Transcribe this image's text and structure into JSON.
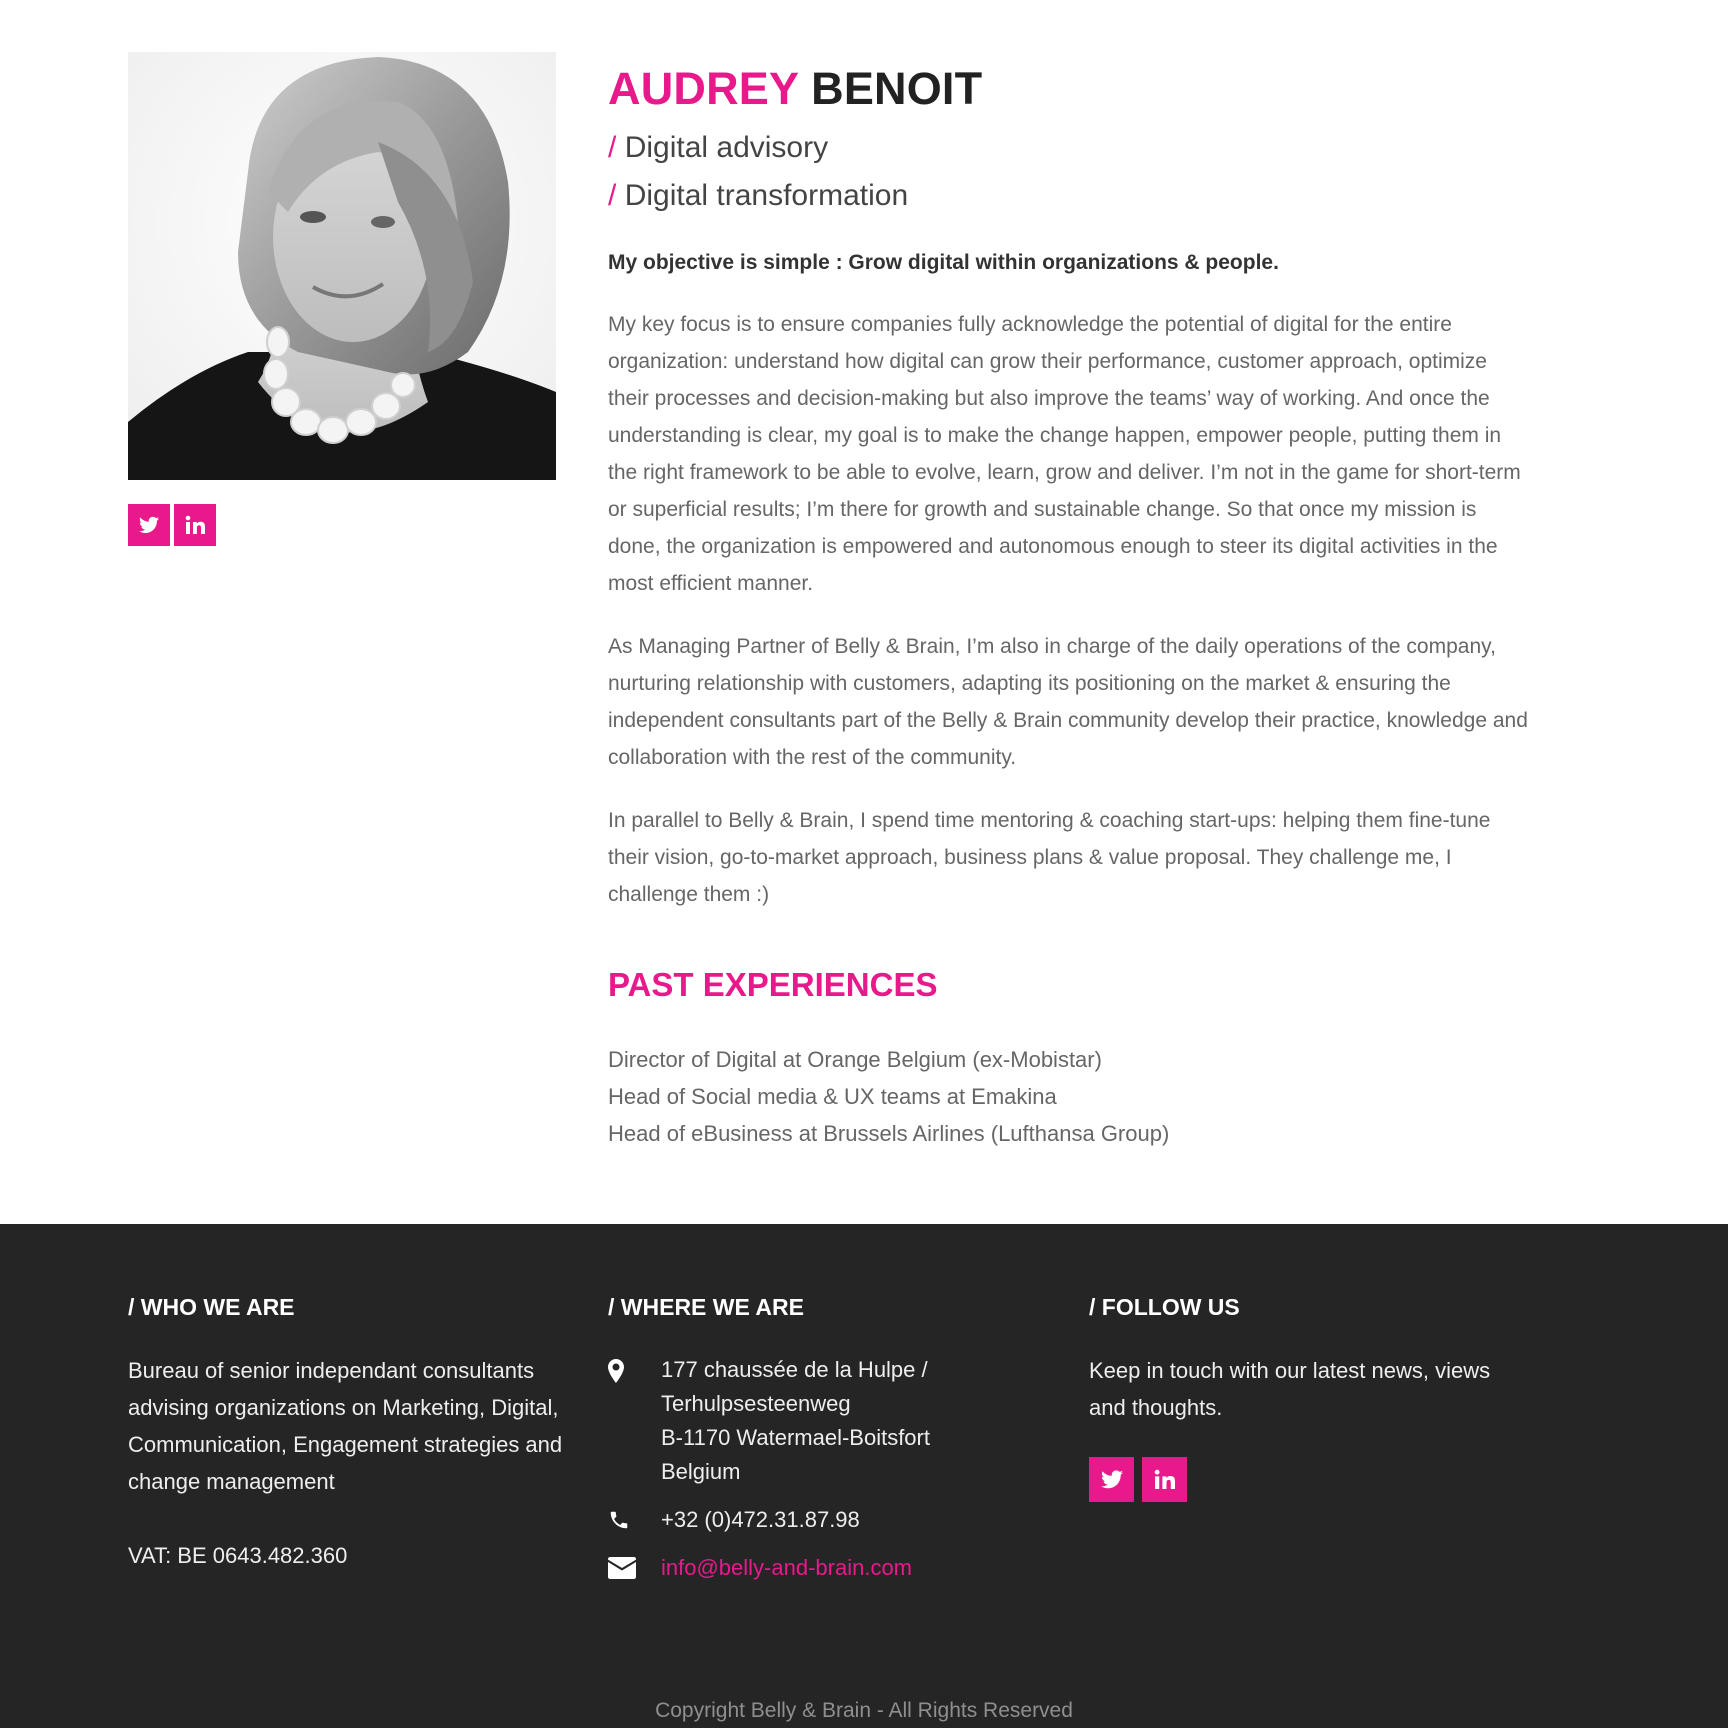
{
  "profile": {
    "first_name": "AUDREY",
    "last_name": "BENOIT",
    "roles": [
      {
        "slash": "/",
        "label": "Digital advisory"
      },
      {
        "slash": "/",
        "label": "Digital transformation"
      }
    ],
    "objective": "My objective is simple : Grow digital within organizations & people.",
    "paragraphs": [
      "My key focus is to ensure companies fully acknowledge the potential of digital for the entire organization: understand how digital can grow their performance, customer approach, optimize their processes and decision-making but also improve the teams’ way of working.  And once the understanding is clear, my goal is to make the change happen, empower people, putting them in the right framework to be able to evolve, learn, grow and deliver. I’m not in the game for short-term or superficial results; I’m there for growth and sustainable change. So that once my mission is done, the organization is empowered and autonomous enough to steer its digital activities in the most efficient manner.",
      "As Managing Partner of Belly & Brain, I’m also in charge of the daily operations of the company, nurturing relationship with customers, adapting its positioning on the market & ensuring the independent consultants part of the Belly & Brain community develop their practice, knowledge and collaboration with the rest of the community.",
      "In parallel to Belly & Brain, I spend time mentoring & coaching start-ups: helping them fine-tune their vision, go-to-market approach, business plans & value proposal. They challenge me, I challenge them :)"
    ],
    "past_title": "PAST EXPERIENCES",
    "experiences": [
      "Director of Digital at Orange Belgium (ex-Mobistar)",
      "Head of Social media & UX teams at Emakina",
      "Head of eBusiness at Brussels Airlines (Lufthansa Group)"
    ],
    "social": [
      "twitter-icon",
      "linkedin-icon"
    ]
  },
  "footer": {
    "who": {
      "title": "/ WHO WE ARE",
      "text": "Bureau of senior independant consultants advising organizations on Marketing, Digital, Communication, Engagement strategies and change management",
      "vat": "VAT: BE 0643.482.360"
    },
    "where": {
      "title": "/ WHERE WE ARE",
      "address_lines": [
        "177 chaussée de la Hulpe /",
        "Terhulpsesteenweg",
        "B-1170 Watermael-Boitsfort",
        "Belgium"
      ],
      "phone": "+32 (0)472.31.87.98",
      "email": "info@belly-and-brain.com"
    },
    "follow": {
      "title": "/ FOLLOW US",
      "text": "Keep in touch with our latest news, views and thoughts."
    },
    "copyright": "Copyright Belly & Brain - All Rights Reserved"
  },
  "colors": {
    "accent": "#e8198b",
    "footer_bg": "#252525",
    "heading_dark": "#222222",
    "body_text": "#666666"
  }
}
